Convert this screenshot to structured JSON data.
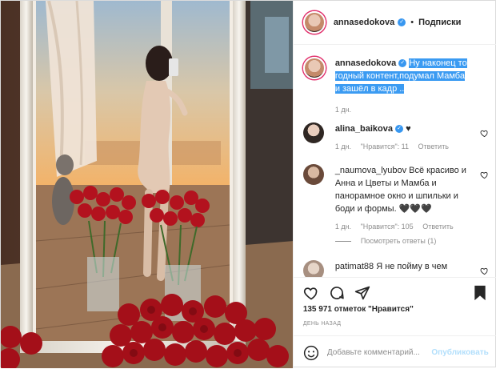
{
  "header": {
    "username": "annasedokova",
    "separator": "•",
    "follow_label": "Подписки"
  },
  "caption": {
    "username": "annasedokova",
    "text": "Ну наконец то годный контент,подумал Мамба и зашёл в кадр ..",
    "time": "1 дн."
  },
  "comments": [
    {
      "username": "alina_baikova",
      "text": "♥",
      "time": "1 дн.",
      "likes": "\"Нравится\": 11",
      "reply": "Ответить"
    },
    {
      "username": "_naumova_lyubov",
      "text": "Всё красиво и Анна и Цветы и Мамба и панорамное окно и шпильки и боди и формы. 🖤🖤🖤",
      "time": "1 дн.",
      "likes": "\"Нравится\": 105",
      "reply": "Ответить"
    },
    {
      "username": "patimat88",
      "text": "Я не пойму в чем"
    }
  ],
  "view_replies": "Посмотреть ответы (1)",
  "likes_text": "135 971 отметок \"Нравится\"",
  "date_text": "ДЕНЬ НАЗАД",
  "add_comment": {
    "placeholder": "Добавьте комментарий...",
    "publish": "Опубликовать"
  },
  "colors": {
    "accent": "#3897f0",
    "highlight": "#3b9bf2",
    "muted": "#8e8e8e",
    "roses": "#b3121e"
  },
  "icons": [
    "heart-icon",
    "comment-icon",
    "share-icon",
    "bookmark-icon",
    "smile-icon",
    "verified-icon"
  ]
}
